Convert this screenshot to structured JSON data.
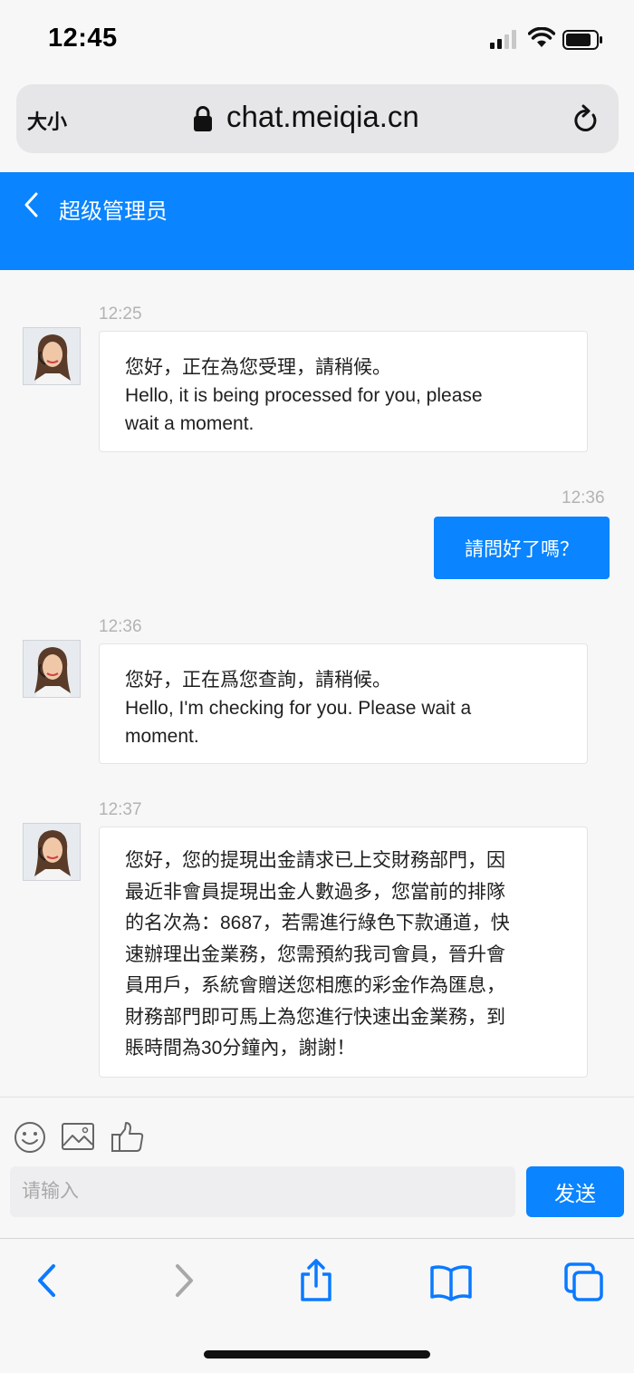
{
  "status": {
    "time": "12:45"
  },
  "browser": {
    "text_size_label": "大小",
    "url": "chat.meiqia.cn"
  },
  "header": {
    "title": "超级管理员"
  },
  "messages": [
    {
      "time": "12:25",
      "lines": [
        "您好，正在為您受理，請稍候。",
        "Hello, it is being processed for you, please",
        "wait a moment."
      ]
    },
    {
      "time": "12:36",
      "text": "請問好了嗎？"
    },
    {
      "time": "12:36",
      "lines": [
        "您好，正在爲您查詢，請稍候。",
        "Hello, I'm checking for you. Please wait a",
        "moment."
      ]
    },
    {
      "time": "12:37",
      "lines": [
        "您好，您的提現出金請求已上交財務部門，因",
        "最近非會員提現出金人數過多，您當前的排隊",
        "的名次為：8687，若需進行綠色下款通道，快",
        "速辦理出金業務，您需預約我司會員，晉升會",
        "員用戶，系統會贈送您相應的彩金作為匯息，",
        "財務部門即可馬上為您進行快速出金業務，到",
        "賬時間為30分鐘內，謝謝！"
      ]
    }
  ],
  "composer": {
    "placeholder": "请输入",
    "send_label": "发送"
  },
  "icons": {
    "signal": "signal-icon",
    "wifi": "wifi-icon",
    "battery": "battery-icon",
    "lock": "lock-icon",
    "reload": "reload-icon",
    "back": "chevron-left-icon",
    "emoji": "emoji-icon",
    "image": "image-icon",
    "like": "thumbs-up-icon",
    "share": "share-icon",
    "bookmarks": "book-icon",
    "tabs": "tabs-icon"
  },
  "colors": {
    "accent": "#0a84ff",
    "background": "#f7f7f8",
    "timestamp": "#b3b3b3"
  }
}
